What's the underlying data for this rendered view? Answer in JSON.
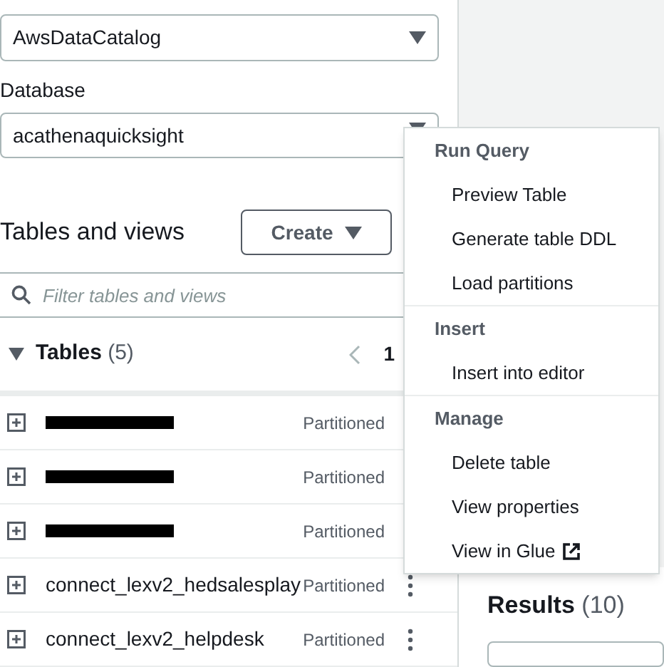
{
  "data_source": {
    "value": "AwsDataCatalog"
  },
  "database": {
    "label": "Database",
    "value": "acathenaquicksight"
  },
  "tables_panel": {
    "title": "Tables and views",
    "create_button": "Create",
    "search": {
      "placeholder": "Filter tables and views"
    }
  },
  "tables": {
    "title": "Tables",
    "count": "(5)",
    "expanded": true,
    "page": "1",
    "rows": [
      {
        "kind": "redacted",
        "tag": "Partitioned"
      },
      {
        "kind": "redacted",
        "tag": "Partitioned"
      },
      {
        "kind": "redacted",
        "tag": "Partitioned"
      },
      {
        "kind": "named",
        "name": "connect_lexv2_hedsalesplay",
        "tag": "Partitioned",
        "menu": true
      },
      {
        "kind": "named",
        "name": "connect_lexv2_helpdesk",
        "tag": "Partitioned",
        "menu": true
      }
    ]
  },
  "results": {
    "title": "Results",
    "count": "(10)"
  },
  "context_menu": {
    "groups": [
      {
        "title": "Run Query",
        "items": [
          {
            "label": "Preview Table",
            "external": false
          },
          {
            "label": "Generate table DDL",
            "external": false
          },
          {
            "label": "Load partitions",
            "external": false
          }
        ]
      },
      {
        "title": "Insert",
        "items": [
          {
            "label": "Insert into editor",
            "external": false
          }
        ]
      },
      {
        "title": "Manage",
        "items": [
          {
            "label": "Delete table",
            "external": false
          },
          {
            "label": "View properties",
            "external": false
          },
          {
            "label": "View in Glue",
            "external": true
          }
        ]
      }
    ]
  }
}
